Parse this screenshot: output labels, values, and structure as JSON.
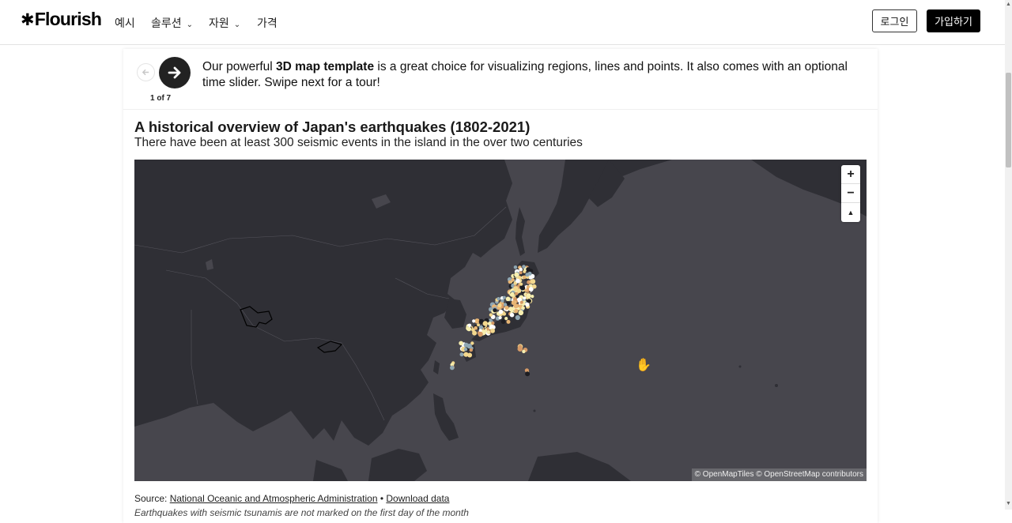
{
  "nav": {
    "logo": "Flourish",
    "items": [
      {
        "label": "예시",
        "dropdown": false
      },
      {
        "label": "솔루션",
        "dropdown": true
      },
      {
        "label": "자원",
        "dropdown": true
      },
      {
        "label": "가격",
        "dropdown": false
      }
    ],
    "login": "로그인",
    "signup": "가입하기"
  },
  "tour": {
    "counter": "1 of 7",
    "text_before": "Our powerful ",
    "text_bold": "3D map template",
    "text_after": " is a great choice for visualizing regions, lines and points. It also comes with an optional time slider. Swipe next for a tour!"
  },
  "viz": {
    "title": "A historical overview of Japan's earthquakes (1802-2021)",
    "subtitle": "There have been at least 300 seismic events in the island in the over two centuries",
    "attribution": "© OpenMapTiles © OpenStreetMap contributors",
    "zoom_in": "+",
    "zoom_out": "−",
    "reset": "▲",
    "colors": {
      "ocean": "#47464d",
      "land": "#2f2f35",
      "points": [
        "#f7efb0",
        "#f3d88e",
        "#e8b574",
        "#d69a66",
        "#ffffff",
        "#8fa7b3",
        "#1d1d22"
      ]
    }
  },
  "source": {
    "prefix": "Source: ",
    "link1": "National Oceanic and Atmospheric Administration",
    "separator": " • ",
    "link2": "Download data"
  },
  "footnote": "Earthquakes with seismic tsunamis are not marked on the first day of the month"
}
